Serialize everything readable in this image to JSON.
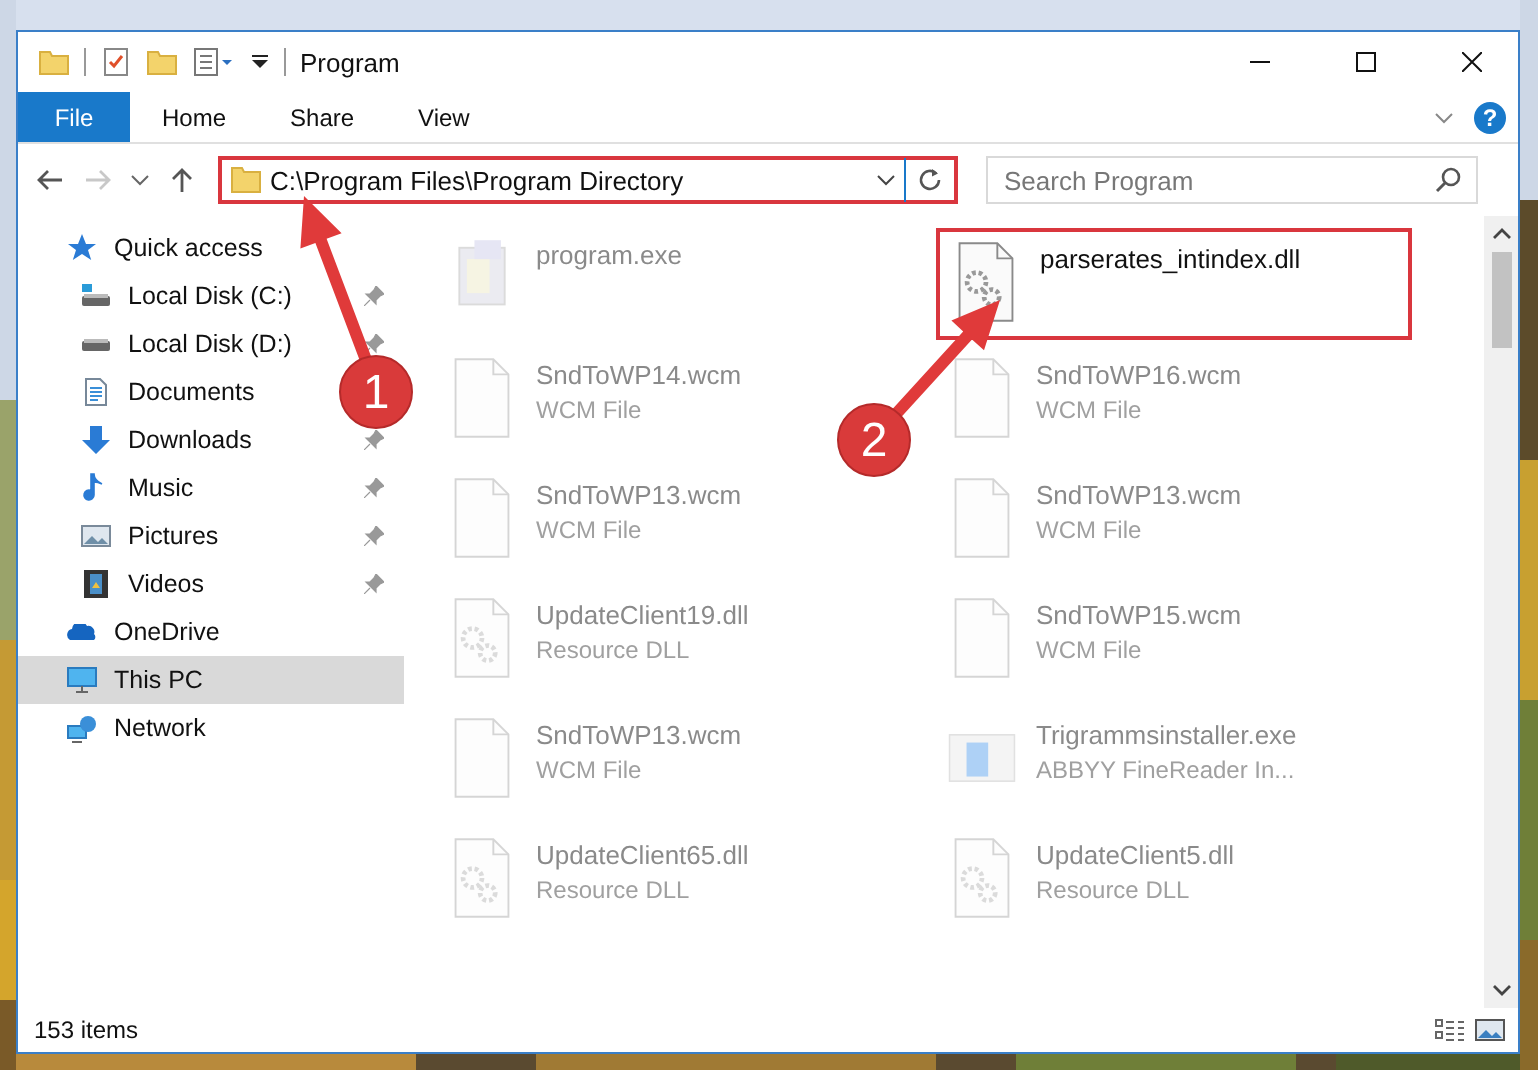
{
  "window": {
    "title": "Program"
  },
  "ribbon": {
    "tabs": [
      {
        "label": "File",
        "kind": "menu"
      },
      {
        "label": "Home",
        "kind": "tab"
      },
      {
        "label": "Share",
        "kind": "tab"
      },
      {
        "label": "View",
        "kind": "tab"
      }
    ],
    "help": "?"
  },
  "navigation": {
    "forward_disabled": true
  },
  "address_bar": {
    "path": "C:\\Program Files\\Program Directory",
    "highlighted": true
  },
  "search": {
    "placeholder": "Search Program"
  },
  "sidebar": {
    "items": [
      {
        "label": "Quick access",
        "selected": false,
        "children": [
          {
            "label": "Local Disk (C:)",
            "pinned": true
          },
          {
            "label": "Local Disk (D:)",
            "pinned": true
          },
          {
            "label": "Documents"
          },
          {
            "label": "Downloads",
            "pinned": true
          },
          {
            "label": "Music",
            "pinned": true
          },
          {
            "label": "Pictures",
            "pinned": true
          },
          {
            "label": "Videos",
            "pinned": true
          }
        ]
      },
      {
        "label": "OneDrive",
        "selected": false
      },
      {
        "label": "This PC",
        "selected": true
      },
      {
        "label": "Network",
        "selected": false
      }
    ]
  },
  "files": [
    {
      "name": "program.exe",
      "kind": "exe",
      "faded": true,
      "highlighted": false
    },
    {
      "name": "parserates_intindex.dll",
      "kind": "dll",
      "faded": false,
      "highlighted": true
    },
    {
      "name": "SndToWP14.wcm",
      "type": "WCM File",
      "kind": "doc",
      "faded": true,
      "highlighted": false
    },
    {
      "name": "SndToWP16.wcm",
      "type": "WCM File",
      "kind": "doc",
      "faded": true,
      "highlighted": false
    },
    {
      "name": "SndToWP13.wcm",
      "type": "WCM File",
      "kind": "doc",
      "faded": true,
      "highlighted": false
    },
    {
      "name": "SndToWP13.wcm",
      "type": "WCM File",
      "kind": "doc",
      "faded": true,
      "highlighted": false
    },
    {
      "name": "UpdateClient19.dll",
      "type": "Resource DLL",
      "kind": "dll",
      "faded": true,
      "highlighted": false
    },
    {
      "name": "SndToWP15.wcm",
      "type": "WCM File",
      "kind": "doc",
      "faded": true,
      "highlighted": false
    },
    {
      "name": "SndToWP13.wcm",
      "type": "WCM File",
      "kind": "doc",
      "faded": true,
      "highlighted": false
    },
    {
      "name": "Trigrammsinstaller.exe",
      "type": "ABBYY FineReader In...",
      "kind": "installer",
      "faded": true,
      "highlighted": false
    },
    {
      "name": "UpdateClient65.dll",
      "type": "Resource DLL",
      "kind": "dll",
      "faded": true,
      "highlighted": false
    },
    {
      "name": "UpdateClient5.dll",
      "type": "Resource DLL",
      "kind": "dll",
      "faded": true,
      "highlighted": false
    }
  ],
  "status_bar": {
    "item_count": "153 items"
  },
  "annotations": [
    {
      "number": "1"
    },
    {
      "number": "2"
    }
  ]
}
